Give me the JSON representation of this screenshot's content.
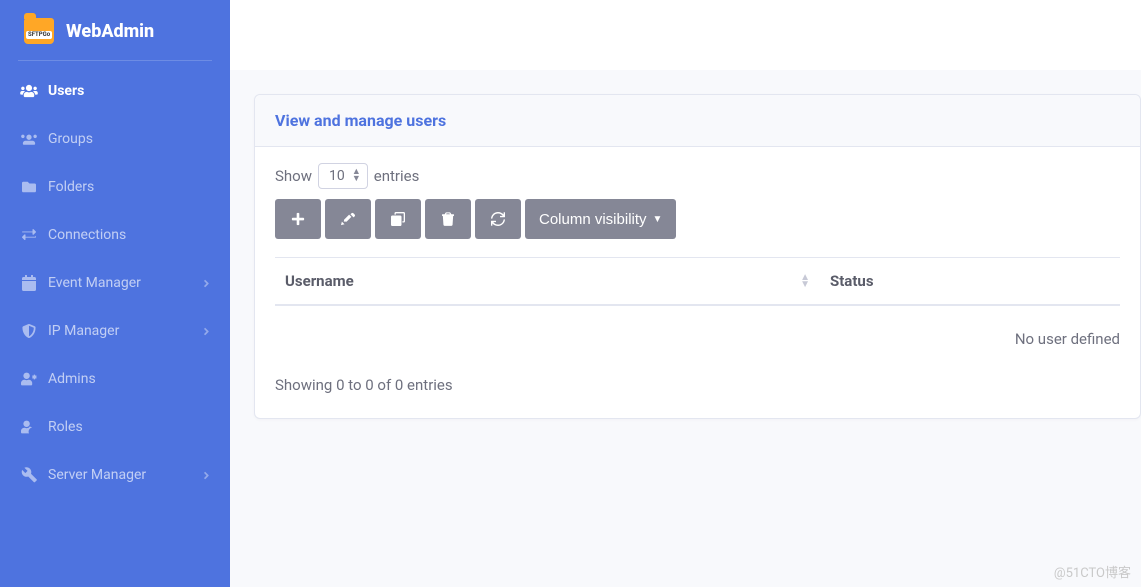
{
  "brand": {
    "name": "WebAdmin",
    "logo_tag": "SFTPGo"
  },
  "sidebar": {
    "items": [
      {
        "label": "Users",
        "icon": "users",
        "active": true,
        "expandable": false
      },
      {
        "label": "Groups",
        "icon": "groups",
        "active": false,
        "expandable": false
      },
      {
        "label": "Folders",
        "icon": "folder",
        "active": false,
        "expandable": false
      },
      {
        "label": "Connections",
        "icon": "exchange",
        "active": false,
        "expandable": false
      },
      {
        "label": "Event Manager",
        "icon": "calendar",
        "active": false,
        "expandable": true
      },
      {
        "label": "IP Manager",
        "icon": "shield",
        "active": false,
        "expandable": true
      },
      {
        "label": "Admins",
        "icon": "admin",
        "active": false,
        "expandable": false
      },
      {
        "label": "Roles",
        "icon": "roles",
        "active": false,
        "expandable": false
      },
      {
        "label": "Server Manager",
        "icon": "tools",
        "active": false,
        "expandable": true
      }
    ]
  },
  "page": {
    "title": "View and manage users",
    "length": {
      "show_label": "Show",
      "entries_label": "entries",
      "selected": "10"
    },
    "toolbar": {
      "column_visibility_label": "Column visibility"
    },
    "table": {
      "columns": {
        "username": "Username",
        "status": "Status"
      },
      "empty_text": "No user defined"
    },
    "showing_info": "Showing 0 to 0 of 0 entries"
  },
  "watermark": "@51CTO博客"
}
